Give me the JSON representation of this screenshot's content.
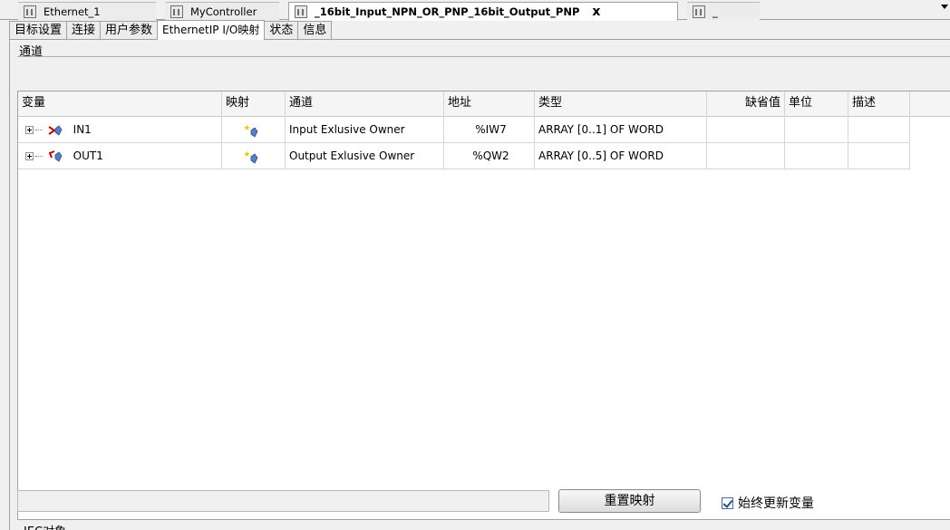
{
  "editor_tabs": [
    {
      "label": "Ethernet_1",
      "active": false
    },
    {
      "label": "MyController",
      "active": false
    },
    {
      "label": "_16bit_Input_NPN_OR_PNP_16bit_Output_PNP",
      "active": true,
      "close": "x"
    },
    {
      "label": "_",
      "active": false
    }
  ],
  "sub_tabs": [
    "目标设置",
    "连接",
    "用户参数",
    "EthernetIP I/O映射",
    "状态",
    "信息"
  ],
  "section_title": "通道",
  "grid": {
    "headers": [
      "变量",
      "映射",
      "通道",
      "地址",
      "类型",
      "缺省值",
      "单位",
      "描述"
    ],
    "rows": [
      {
        "variable": "IN1",
        "channel": "Input Exlusive Owner",
        "address": "%IW7",
        "type": "ARRAY [0..1] OF WORD",
        "default": "",
        "unit": "",
        "desc": ""
      },
      {
        "variable": "OUT1",
        "channel": "Output Exlusive Owner",
        "address": "%QW2",
        "type": "ARRAY [0..5] OF WORD",
        "default": "",
        "unit": "",
        "desc": ""
      }
    ]
  },
  "buttons": {
    "reset_mapping": "重置映射"
  },
  "checkbox": {
    "label": "始终更新变量",
    "checked": true
  },
  "bottom_label": "IEC对象"
}
